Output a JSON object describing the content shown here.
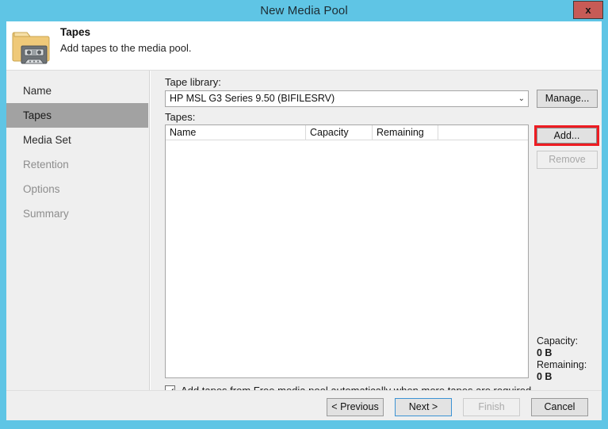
{
  "window": {
    "title": "New Media Pool",
    "close_label": "x",
    "accent_color": "#5FC5E5",
    "close_color": "#C75B56",
    "highlight_color": "#EE1C22"
  },
  "header": {
    "title": "Tapes",
    "subtitle": "Add tapes to the media pool.",
    "icon": "folder-with-tape-icon"
  },
  "sidebar": {
    "items": [
      {
        "label": "Name",
        "state": "visited"
      },
      {
        "label": "Tapes",
        "state": "selected"
      },
      {
        "label": "Media Set",
        "state": "visited"
      },
      {
        "label": "Retention",
        "state": "disabled"
      },
      {
        "label": "Options",
        "state": "disabled"
      },
      {
        "label": "Summary",
        "state": "disabled"
      }
    ]
  },
  "content": {
    "tape_library_label": "Tape library:",
    "tape_library_value": "HP MSL G3 Series 9.50 (BIFILESRV)",
    "tape_library_chevron": "⌄",
    "manage_label": "Manage...",
    "tapes_label": "Tapes:",
    "table": {
      "columns": [
        "Name",
        "Capacity",
        "Remaining",
        ""
      ],
      "rows": []
    },
    "add_label": "Add...",
    "remove_label": "Remove",
    "capacity_label": "Capacity:",
    "capacity_value": "0 B",
    "remaining_label": "Remaining:",
    "remaining_value": "0 B",
    "autoadd_label": "Add tapes from Free media pool automatically when more tapes are required",
    "autoadd_checked": true
  },
  "footer": {
    "previous_label": "< Previous",
    "next_label": "Next >",
    "finish_label": "Finish",
    "cancel_label": "Cancel"
  }
}
